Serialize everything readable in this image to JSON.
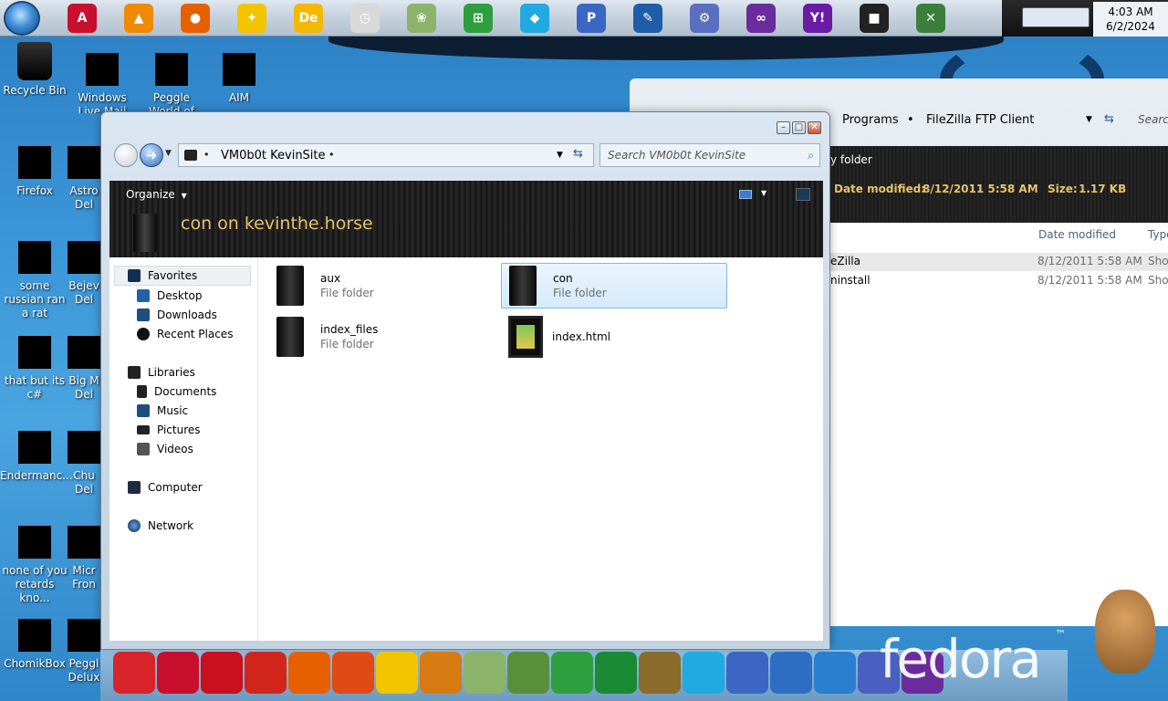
{
  "taskbar": {
    "icons": [
      {
        "name": "adobe-reader-icon",
        "glyph": "A",
        "color": "#c8102e"
      },
      {
        "name": "vlc-icon",
        "glyph": "▲",
        "color": "#f08a00"
      },
      {
        "name": "firefox-icon",
        "glyph": "●",
        "color": "#e66000"
      },
      {
        "name": "aim-icon",
        "glyph": "✦",
        "color": "#f3c400"
      },
      {
        "name": "dreamweaver-icon",
        "glyph": "De",
        "color": "#f5b800"
      },
      {
        "name": "clock-gadget-icon",
        "glyph": "◷",
        "color": "#d9d9d9"
      },
      {
        "name": "flower-icon",
        "glyph": "❀",
        "color": "#8bb36a"
      },
      {
        "name": "windows-update-icon",
        "glyph": "⊞",
        "color": "#2e9e3f"
      },
      {
        "name": "gem-icon",
        "glyph": "◆",
        "color": "#21a9e1"
      },
      {
        "name": "peggle-icon",
        "glyph": "P",
        "color": "#3b66c4"
      },
      {
        "name": "paint-icon",
        "glyph": "✎",
        "color": "#1f5da8"
      },
      {
        "name": "installer-icon",
        "glyph": "⚙",
        "color": "#5a6fc0"
      },
      {
        "name": "visual-studio-icon",
        "glyph": "∞",
        "color": "#6a2c9c"
      },
      {
        "name": "yahoo-messenger-icon",
        "glyph": "Y!",
        "color": "#6b1aa3"
      },
      {
        "name": "window-icon",
        "glyph": "■",
        "color": "#222222"
      },
      {
        "name": "network-users-icon",
        "glyph": "✕",
        "color": "#3c7f3c"
      }
    ],
    "clock_time": "4:03 AM",
    "clock_date": "6/2/2024"
  },
  "desktop_icons": [
    {
      "label": "Recycle Bin"
    },
    {
      "label": "Windows Live Mail"
    },
    {
      "label": "Peggle World of Warcraft"
    },
    {
      "label": "AIM"
    },
    {
      "label": "Firefox"
    },
    {
      "label": "Astro Del"
    },
    {
      "label": "some russian ran a rat"
    },
    {
      "label": "Bejev Del"
    },
    {
      "label": "that but its c#"
    },
    {
      "label": "Big M Del"
    },
    {
      "label": "Endermanc..."
    },
    {
      "label": "Chu Del"
    },
    {
      "label": "none of you retards kno..."
    },
    {
      "label": "Micr Fron"
    },
    {
      "label": "ChomikBox"
    },
    {
      "label": "Peggl Delux"
    }
  ],
  "bg_window": {
    "breadcrumb": [
      "Programs",
      "FileZilla FTP Client"
    ],
    "search_label": "Search",
    "pane_title": "y folder",
    "date_modified_label": "Date modified:",
    "date_modified_value": "8/12/2011 5:58 AM",
    "size_label": "Size:",
    "size_value": "1.17 KB",
    "col_date": "Date modified",
    "col_type": "Type",
    "rows": [
      {
        "name": "eZilla",
        "date": "8/12/2011 5:58 AM",
        "type": "Shor"
      },
      {
        "name": "ninstall",
        "date": "8/12/2011 5:58 AM",
        "type": "Shor"
      }
    ]
  },
  "explorer": {
    "address": "VM0b0t KevinSite",
    "search_placeholder": "Search VM0b0t KevinSite",
    "organize": "Organize",
    "view_title": "con on kevinthe.horse",
    "nav": {
      "favorites": "Favorites",
      "desktop": "Desktop",
      "downloads": "Downloads",
      "recent": "Recent Places",
      "libraries": "Libraries",
      "documents": "Documents",
      "music": "Music",
      "pictures": "Pictures",
      "videos": "Videos",
      "computer": "Computer",
      "network": "Network"
    },
    "files": [
      {
        "name": "aux",
        "type": "File folder"
      },
      {
        "name": "con",
        "type": "File folder"
      },
      {
        "name": "index_files",
        "type": "File folder"
      },
      {
        "name": "index.html",
        "type": ""
      }
    ]
  },
  "bottom_dock": {
    "branding": "fedora",
    "trademark": "™"
  }
}
